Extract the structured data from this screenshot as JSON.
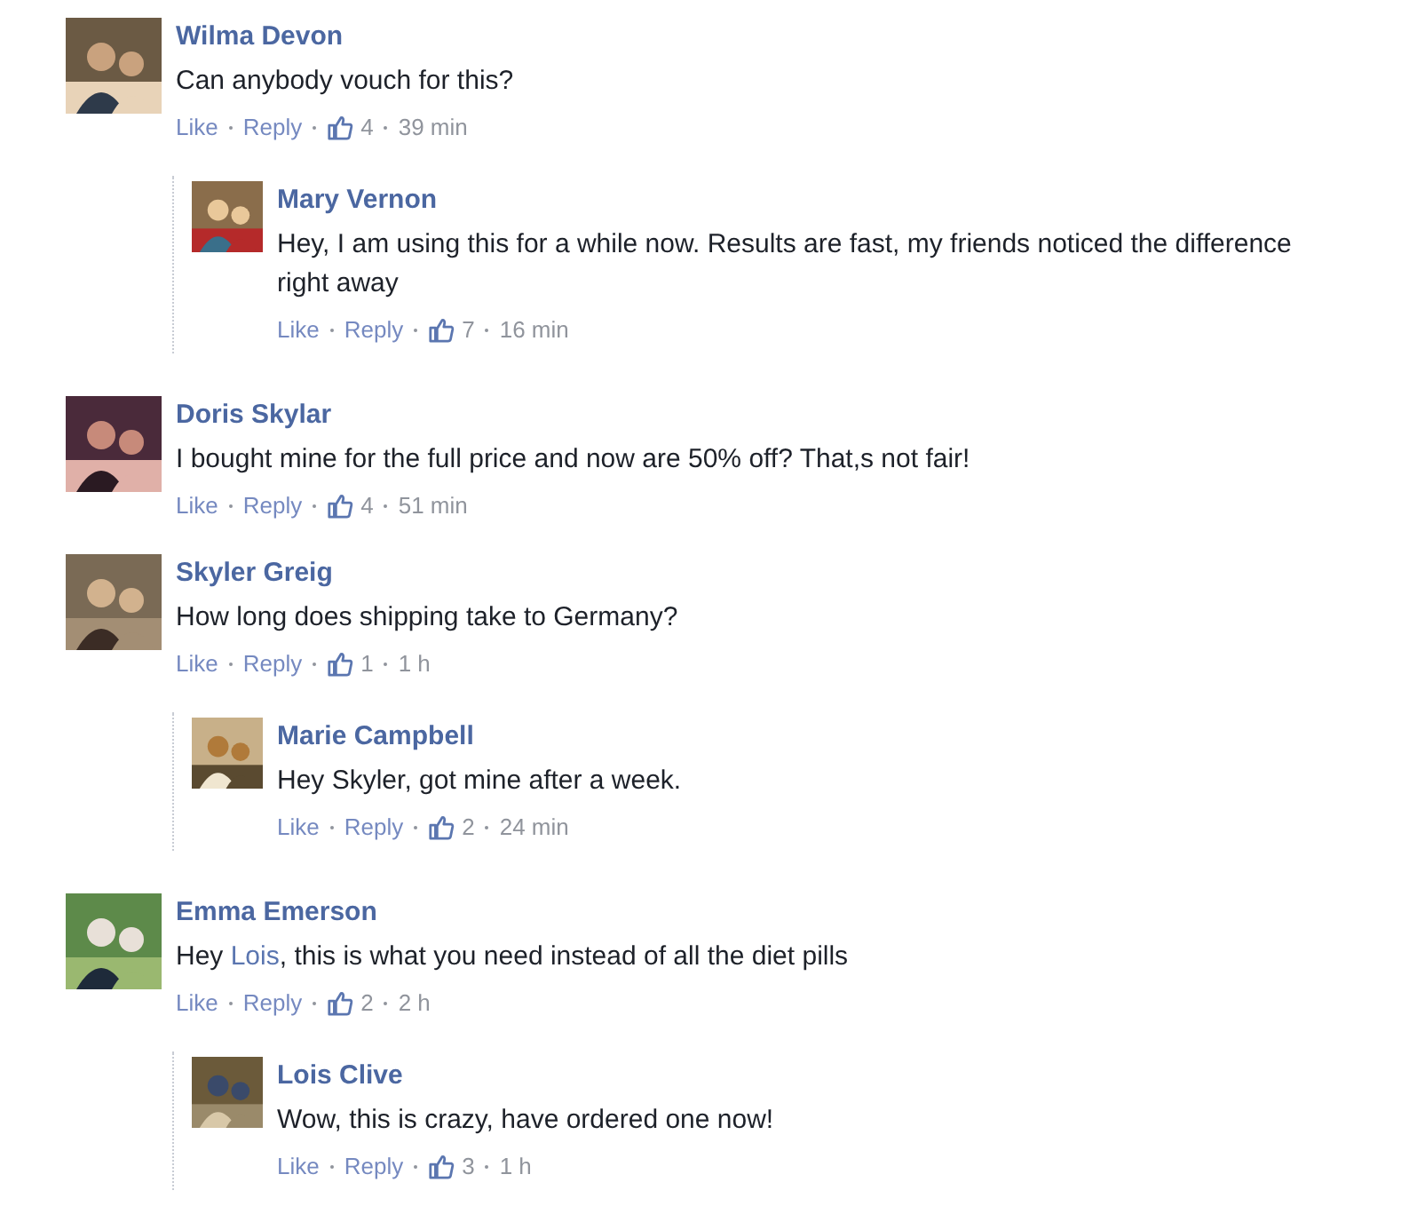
{
  "comments": [
    {
      "name": "Wilma Devon",
      "segments": [
        {
          "kind": "plain",
          "text": "Can anybody vouch for this?"
        }
      ],
      "like": "Like",
      "reply": "Reply",
      "likes": "4",
      "time": "39 min",
      "replies": [
        {
          "name": "Mary Vernon",
          "segments": [
            {
              "kind": "plain",
              "text": "Hey, I am using this for a while now. Results are fast, my friends noticed the difference right away"
            }
          ],
          "like": "Like",
          "reply": "Reply",
          "likes": "7",
          "time": "16 min"
        }
      ]
    },
    {
      "name": "Doris Skylar",
      "segments": [
        {
          "kind": "plain",
          "text": "I bought mine for the full price and now are 50% off? That,s not fair!"
        }
      ],
      "like": "Like",
      "reply": "Reply",
      "likes": "4",
      "time": "51 min"
    },
    {
      "name": "Skyler Greig",
      "segments": [
        {
          "kind": "plain",
          "text": "How long does shipping take to Germany?"
        }
      ],
      "like": "Like",
      "reply": "Reply",
      "likes": "1",
      "time": "1 h",
      "replies": [
        {
          "name": "Marie Campbell",
          "segments": [
            {
              "kind": "plain",
              "text": "Hey Skyler, got mine after a week."
            }
          ],
          "like": "Like",
          "reply": "Reply",
          "likes": "2",
          "time": "24 min"
        }
      ]
    },
    {
      "name": "Emma Emerson",
      "segments": [
        {
          "kind": "plain",
          "text": "Hey "
        },
        {
          "kind": "mention",
          "text": "Lois"
        },
        {
          "kind": "plain",
          "text": ", this is what you need instead of all the diet pills"
        }
      ],
      "like": "Like",
      "reply": "Reply",
      "likes": "2",
      "time": "2 h",
      "replies": [
        {
          "name": "Lois Clive",
          "segments": [
            {
              "kind": "plain",
              "text": "Wow, this is crazy, have ordered one now!"
            }
          ],
          "like": "Like",
          "reply": "Reply",
          "likes": "3",
          "time": "1 h"
        }
      ]
    }
  ]
}
